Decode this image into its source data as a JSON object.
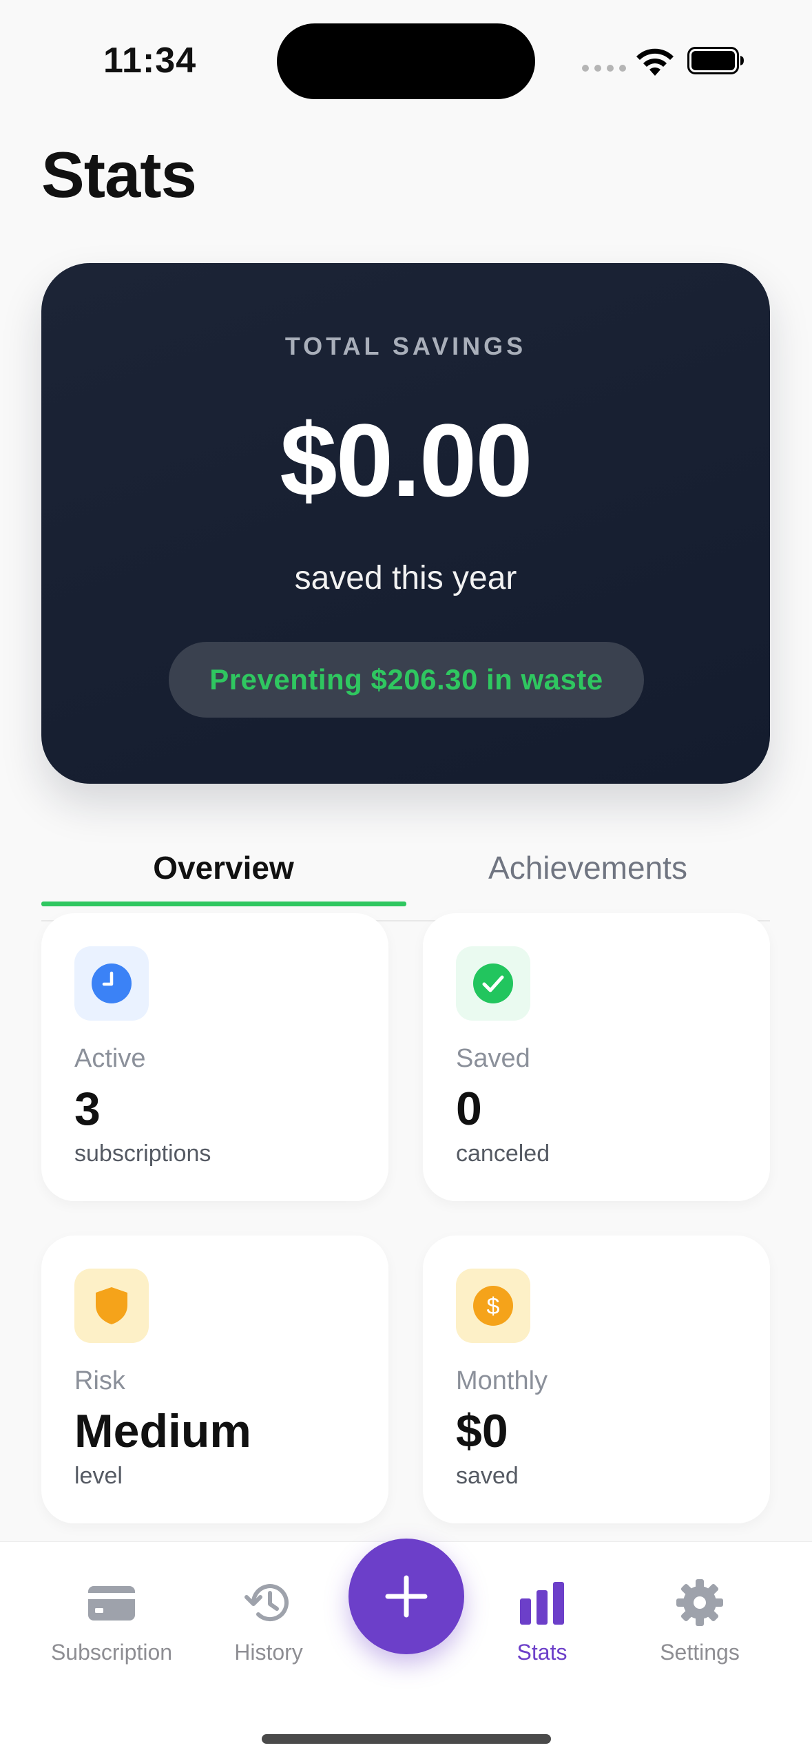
{
  "status_bar": {
    "time": "11:34"
  },
  "page": {
    "title": "Stats"
  },
  "savings": {
    "label": "TOTAL SAVINGS",
    "amount": "$0.00",
    "subtitle": "saved this year",
    "waste_text": "Preventing $206.30 in waste"
  },
  "tabs": [
    {
      "label": "Overview",
      "active": true
    },
    {
      "label": "Achievements",
      "active": false
    }
  ],
  "stats": [
    {
      "label": "Active",
      "value": "3",
      "sub": "subscriptions",
      "icon": "clock-icon",
      "color": "#3b82f6",
      "bg": "#eaf2ff"
    },
    {
      "label": "Saved",
      "value": "0",
      "sub": "canceled",
      "icon": "checkmark-icon",
      "color": "#22c55e",
      "bg": "#eafaf0"
    },
    {
      "label": "Risk",
      "value": "Medium",
      "sub": "level",
      "icon": "shield-icon",
      "color": "#f5a31a",
      "bg": "#fdf0c7"
    },
    {
      "label": "Monthly",
      "value": "$0",
      "sub": "saved",
      "icon": "dollar-icon",
      "color": "#f5a31a",
      "bg": "#fdf0c7"
    }
  ],
  "nav": {
    "items": [
      {
        "label": "Subscription",
        "icon": "credit-card-icon"
      },
      {
        "label": "History",
        "icon": "history-icon"
      },
      {
        "label": "Stats",
        "icon": "bar-chart-icon",
        "active": true
      },
      {
        "label": "Settings",
        "icon": "gear-icon"
      }
    ],
    "fab_icon": "plus-icon",
    "active_color": "#6c3fc9",
    "inactive_color": "#8e8e93"
  },
  "colors": {
    "accent": "#6c3fc9",
    "success": "#2fc760",
    "card_dark": "#1a2233"
  }
}
